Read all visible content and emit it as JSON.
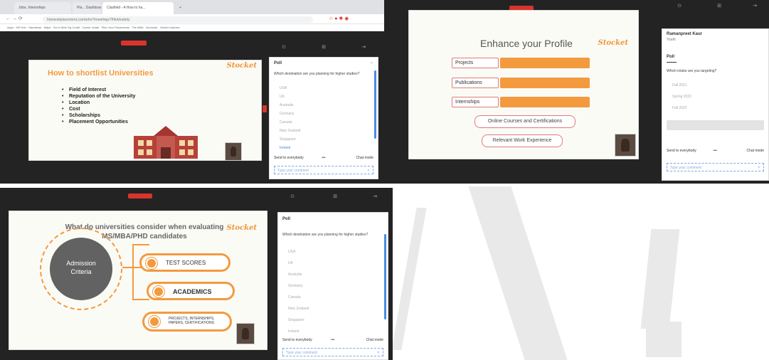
{
  "colors": {
    "accent": "#f39a3e",
    "record": "#d9342b",
    "dark_bg": "#232323",
    "link": "#4b8be0"
  },
  "screenshot1": {
    "browser": {
      "tabs": [
        "Jobs, Internships",
        "Pla... Dashboard",
        "Clasfield - A How to ha...",
        "+"
      ],
      "url": "hireworkplacement.com/who?/meetings?/hfub/ualoty",
      "bookmarks": [
        "Apps",
        "HR Hub",
        "Handbook",
        "Maps",
        "Go to Web Gg Credit",
        "Career Guide",
        "Plan Your Placements",
        "The MBA",
        "Accounts",
        "Gemini Indexes"
      ]
    },
    "slide": {
      "title": "How to shortlist Universities",
      "logo": "Stocket",
      "bullets": [
        "Field of Interest",
        "Reputation of the University",
        "Location",
        "Cost",
        "Scholarships",
        "Placement Opportunities"
      ]
    },
    "poll": {
      "title": "Poll",
      "question": "Which destination are you planning for higher studies?",
      "options": [
        "USA",
        "UK",
        "Australia",
        "Germany",
        "Canada",
        "New Zealand",
        "Singapore",
        "Ireland"
      ],
      "send_label": "Send to everybody",
      "more": "•••",
      "chat_mode": "Chat mode",
      "placeholder": "Type your comment"
    }
  },
  "screenshot2": {
    "slide": {
      "title": "Enhance your Profile",
      "logo": "Stocket",
      "bars": [
        "Projects",
        "Publications",
        "Internships"
      ],
      "pills": [
        "Online Courses and Certifications",
        "Relevant Work Experience"
      ]
    },
    "poll": {
      "user": "Ramanpreet Kaur",
      "role": "Youth",
      "title": "Poll",
      "question": "Which intake are you targeting?",
      "options": [
        "Fall 2021",
        "Spring 2022",
        "Fall 2022"
      ],
      "send_label": "Send to everybody",
      "more": "•••",
      "chat_mode": "Chat mode",
      "placeholder": "Type your comment"
    }
  },
  "screenshot3": {
    "slide": {
      "title_line1": "What do universities consider when evaluating",
      "title_line2": "MS/MBA/PHD candidates",
      "logo": "Stocket",
      "center_line1": "Admission",
      "center_line2": "Criteria",
      "criteria": [
        "TEST SCORES",
        "ACADEMICS",
        "PROJECTS, INTERNSHIPS, PAPERS, CERTIFICATIONS"
      ]
    },
    "poll": {
      "title": "Poll",
      "question": "Which destination are you planning for higher studies?",
      "options": [
        "USA",
        "UK",
        "Australia",
        "Germany",
        "Canada",
        "New Zealand",
        "Singapore",
        "Ireland"
      ],
      "send_label": "Send to everybody",
      "more": "•••",
      "chat_mode": "Chat mode",
      "placeholder": "Type your comment"
    }
  }
}
